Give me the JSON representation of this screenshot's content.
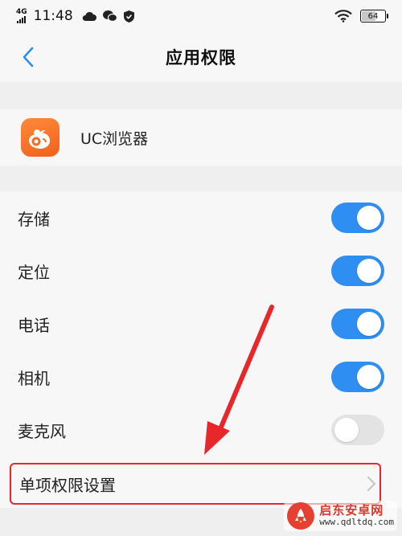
{
  "status_bar": {
    "network": "4G",
    "time": "11:48",
    "battery": "64",
    "battery_level": 0.64,
    "icons": [
      "cloud-icon",
      "wechat-icon",
      "shield-icon",
      "wifi-icon",
      "battery-icon"
    ]
  },
  "header": {
    "title": "应用权限",
    "back_icon": "chevron-left-icon"
  },
  "app": {
    "name": "UC浏览器",
    "icon": "uc-browser-icon",
    "icon_color": "#f36d21"
  },
  "permissions": [
    {
      "label": "存储",
      "enabled": true
    },
    {
      "label": "定位",
      "enabled": true
    },
    {
      "label": "电话",
      "enabled": true
    },
    {
      "label": "相机",
      "enabled": true
    },
    {
      "label": "麦克风",
      "enabled": false
    }
  ],
  "single_settings": {
    "label": "单项权限设置",
    "icon": "chevron-right-icon"
  },
  "colors": {
    "toggle_on": "#2f8ef2",
    "toggle_off": "#e3e3e3",
    "accent": "#2f8ef2",
    "annotation": "#e8272b"
  },
  "watermark": {
    "title": "启东安卓网",
    "url": "www.qdltdq.com"
  }
}
